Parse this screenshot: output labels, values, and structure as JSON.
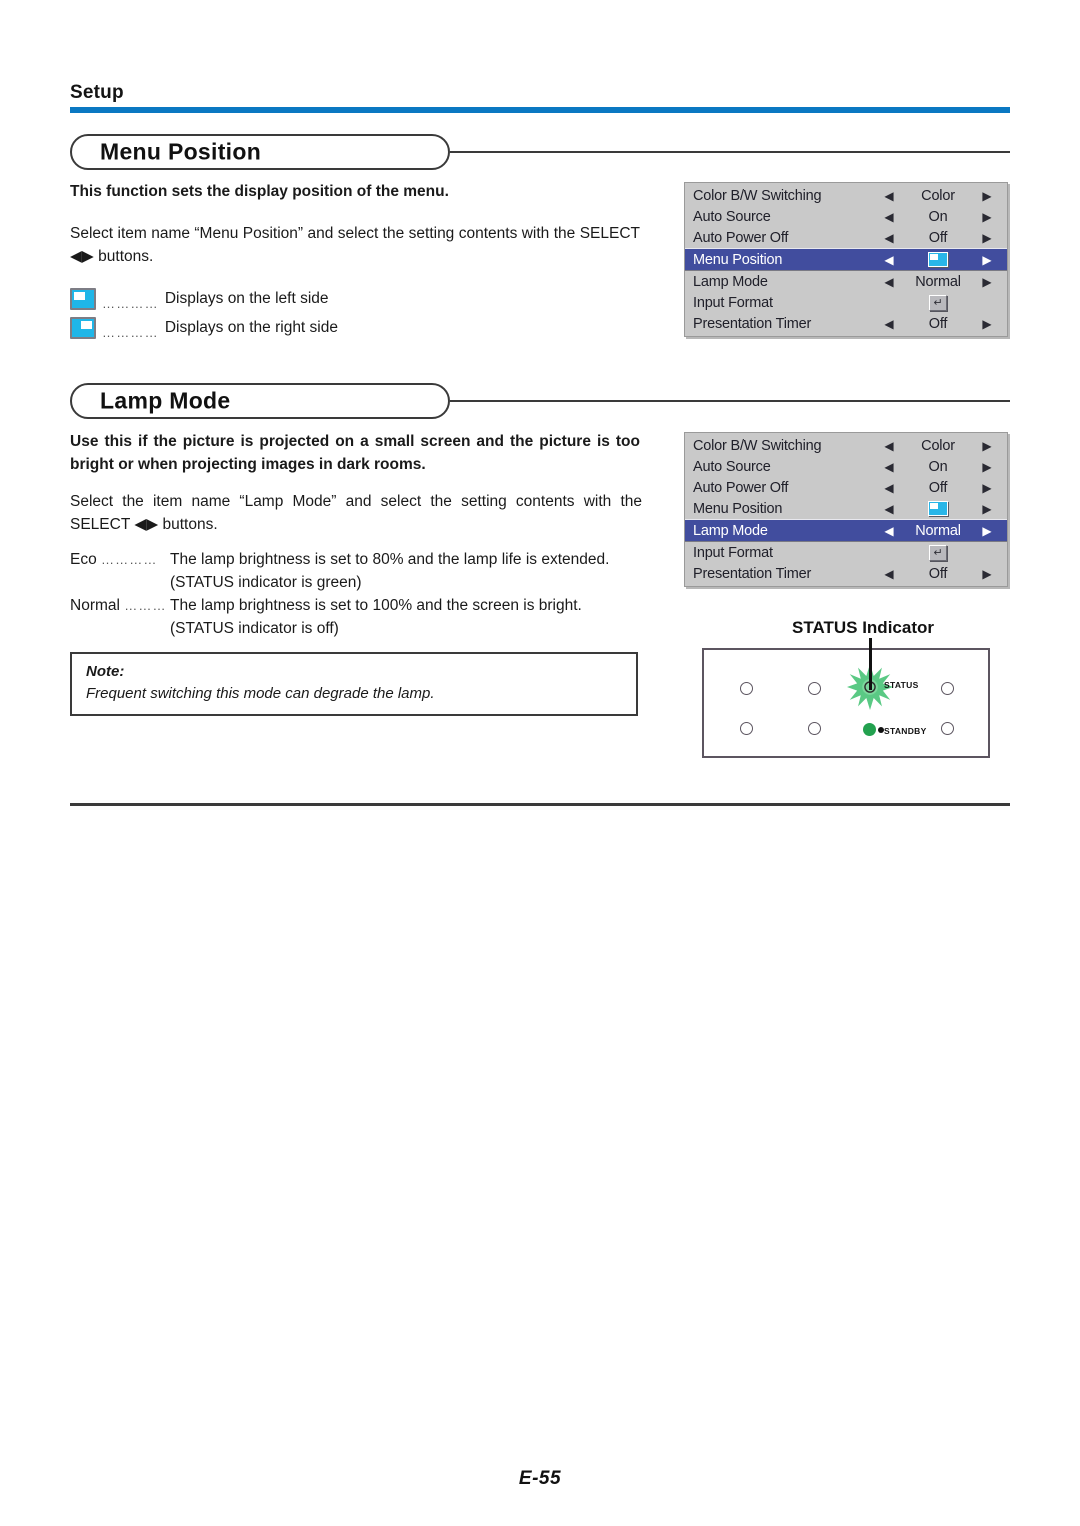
{
  "page": {
    "section_label": "Setup",
    "folio": "E-55",
    "accent_blue": "#0a78c2",
    "osd_highlight": "#414d9e",
    "osd_background": "#c9c9c9",
    "icon_cyan": "#1fb6e8",
    "status_green": "#23a14f"
  },
  "menu_position": {
    "title": "Menu Position",
    "intro": "This function sets the display position of the menu.",
    "instruction": "Select item name “Menu Position” and select the setting contents with the SELECT ◀▶ buttons.",
    "options": [
      {
        "icon": "menu-left-position-icon",
        "leader": "…………",
        "text": "Displays on the left side"
      },
      {
        "icon": "menu-right-position-icon",
        "leader": "…………",
        "text": "Displays on the right side"
      }
    ]
  },
  "lamp_mode": {
    "title": "Lamp Mode",
    "intro": "Use this if the picture is projected on a small screen and the picture is too bright or when projecting images in dark rooms.",
    "instruction": "Select the item name “Lamp Mode” and select the setting contents with the SELECT ◀▶ buttons.",
    "definitions": [
      {
        "term": "Eco",
        "leader": "…………",
        "body": "The lamp brightness is set to 80% and the lamp life is extended.",
        "sub": "(STATUS indicator is green)"
      },
      {
        "term": "Normal",
        "leader": "………",
        "body": "The lamp brightness is set to 100% and the screen is bright.",
        "sub": "(STATUS indicator is off)"
      }
    ],
    "note": {
      "label": "Note:",
      "text": "Frequent switching this mode can degrade the lamp."
    }
  },
  "osd_menu_1": {
    "selected_index": 3,
    "rows": [
      {
        "name": "Color B/W Switching",
        "left_arrow": "◀",
        "value": "Color",
        "value_type": "text",
        "right_arrow": "▶"
      },
      {
        "name": "Auto Source",
        "left_arrow": "◀",
        "value": "On",
        "value_type": "text",
        "right_arrow": "▶"
      },
      {
        "name": "Auto Power Off",
        "left_arrow": "◀",
        "value": "Off",
        "value_type": "text",
        "right_arrow": "▶"
      },
      {
        "name": "Menu Position",
        "left_arrow": "◀",
        "value": "",
        "value_type": "position-icon",
        "right_arrow": "▶"
      },
      {
        "name": "Lamp Mode",
        "left_arrow": "◀",
        "value": "Normal",
        "value_type": "text",
        "right_arrow": "▶"
      },
      {
        "name": "Input Format",
        "left_arrow": "",
        "value": "↵",
        "value_type": "enter-icon",
        "right_arrow": ""
      },
      {
        "name": "Presentation Timer",
        "left_arrow": "◀",
        "value": "Off",
        "value_type": "text",
        "right_arrow": "▶"
      }
    ]
  },
  "osd_menu_2": {
    "selected_index": 4,
    "rows": [
      {
        "name": "Color B/W Switching",
        "left_arrow": "◀",
        "value": "Color",
        "value_type": "text",
        "right_arrow": "▶"
      },
      {
        "name": "Auto Source",
        "left_arrow": "◀",
        "value": "On",
        "value_type": "text",
        "right_arrow": "▶"
      },
      {
        "name": "Auto Power Off",
        "left_arrow": "◀",
        "value": "Off",
        "value_type": "text",
        "right_arrow": "▶"
      },
      {
        "name": "Menu Position",
        "left_arrow": "◀",
        "value": "",
        "value_type": "position-icon",
        "right_arrow": "▶"
      },
      {
        "name": "Lamp Mode",
        "left_arrow": "◀",
        "value": "Normal",
        "value_type": "text",
        "right_arrow": "▶"
      },
      {
        "name": "Input Format",
        "left_arrow": "",
        "value": "↵",
        "value_type": "enter-icon",
        "right_arrow": ""
      },
      {
        "name": "Presentation Timer",
        "left_arrow": "◀",
        "value": "Off",
        "value_type": "text",
        "right_arrow": "▶"
      }
    ]
  },
  "status_indicator": {
    "caption": "STATUS Indicator",
    "status_label": "STATUS",
    "standby_label": "STANDBY"
  }
}
